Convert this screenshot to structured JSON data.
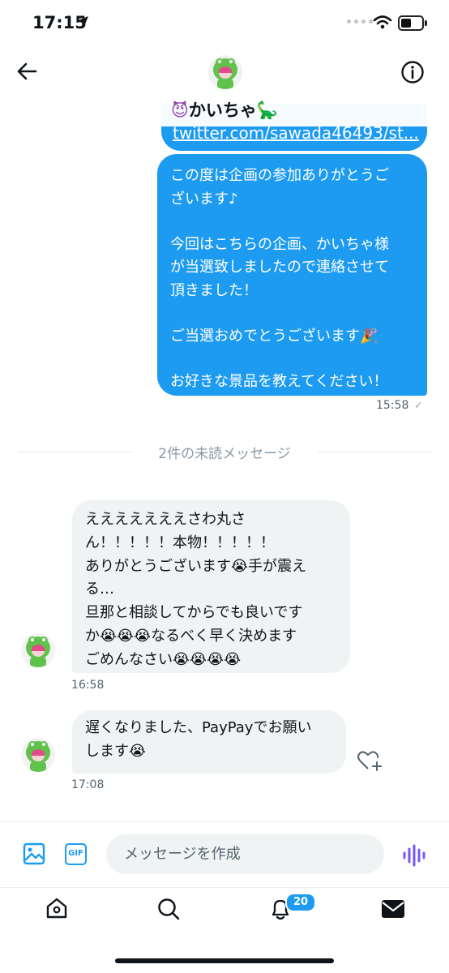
{
  "status_bar": {
    "time": "17:15",
    "battery_level": 0.45
  },
  "header": {
    "title": "かいちゃ",
    "title_emoji_left": "😈",
    "title_emoji_right": "🦕",
    "back_icon": "arrow-left-icon",
    "info_icon": "info-circle-icon"
  },
  "messages": {
    "link_text": "twitter.com/sawada46493/st...",
    "outgoing": {
      "lines": [
        "この度は企画の参加ありがとうご",
        "ざいます♪",
        "",
        "今回はこちらの企画、かいちゃ様",
        "が当選致しましたので連絡させて",
        "頂きました！",
        "",
        "ご当選おめでとうございます🎉",
        "",
        "お好きな景品を教えてください！"
      ],
      "time": "15:58",
      "status_mark": "✓"
    },
    "unread_divider": "2件の未読メッセージ",
    "incoming": [
      {
        "lines": [
          "えええええええさわ丸さ",
          "ん！！！！！本物！！！！！",
          "ありがとうございます😭手が震え",
          "る…",
          "旦那と相談してからでも良いです",
          "か😭😭😭なるべく早く決めます",
          "ごめんなさい😭😭😭😭"
        ],
        "time": "16:58"
      },
      {
        "lines": [
          "遅くなりました、PayPayでお願い",
          "します😭"
        ],
        "time": "17:08"
      }
    ]
  },
  "composer": {
    "placeholder": "メッセージを作成",
    "gif_label": "GIF",
    "image_icon": "image-icon",
    "voice_icon": "voice-wave-icon"
  },
  "tab_bar": {
    "items": [
      "home-icon",
      "search-icon",
      "bell-icon",
      "mail-icon"
    ],
    "notification_count": "20"
  },
  "colors": {
    "accent": "#1d9bf0",
    "incoming_bubble": "#eff3f4",
    "voice": "#7856ff"
  }
}
